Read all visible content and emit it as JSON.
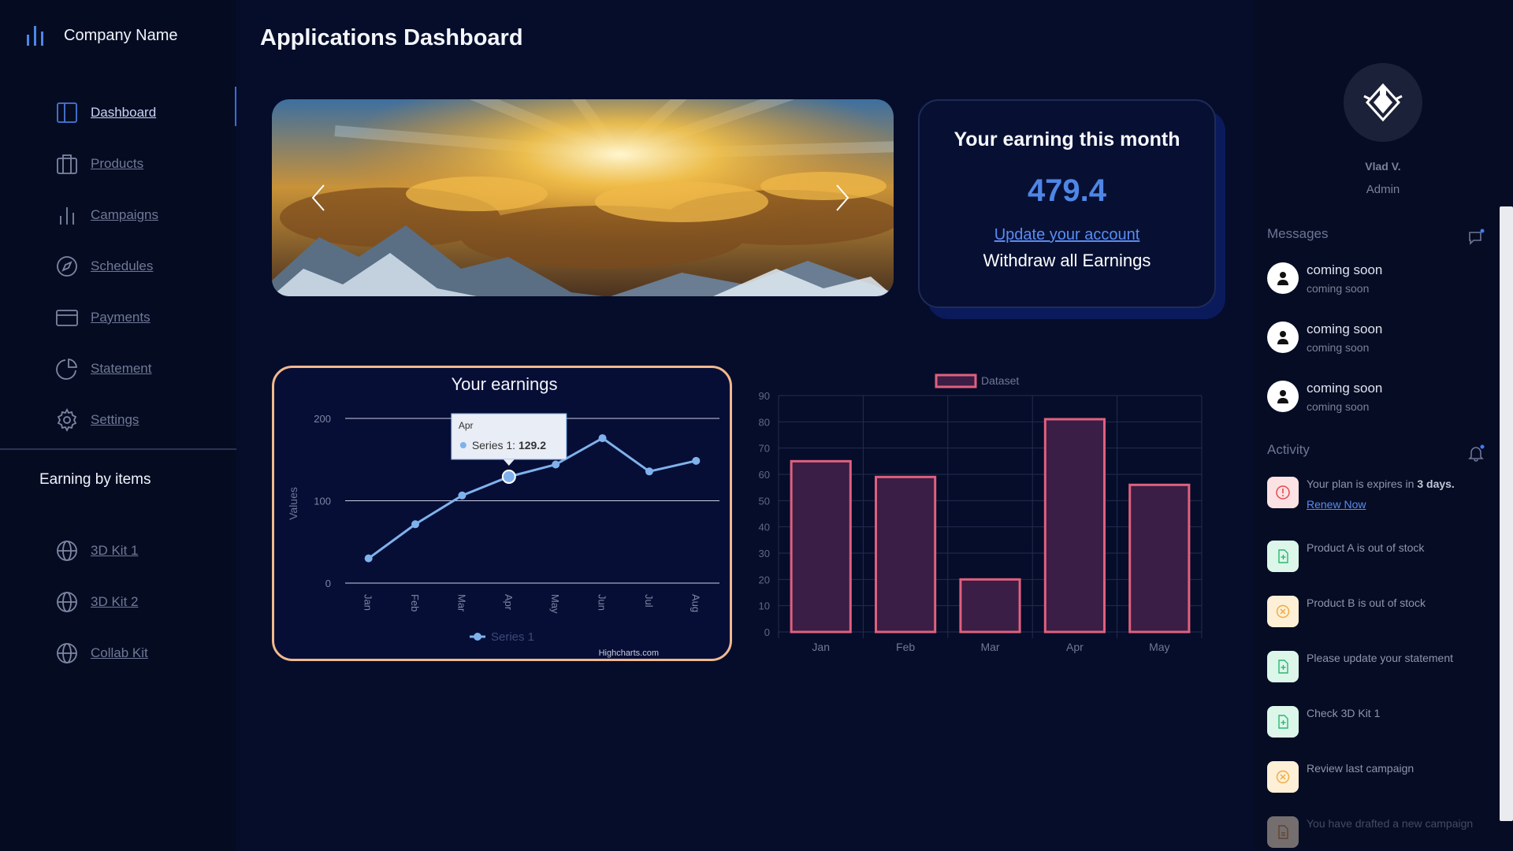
{
  "brand": {
    "name": "Company Name",
    "icon": "bar-chart-icon"
  },
  "page": {
    "title": "Applications Dashboard"
  },
  "nav": [
    {
      "label": "Dashboard",
      "icon": "layout-icon",
      "active": true
    },
    {
      "label": "Products",
      "icon": "briefcase-icon"
    },
    {
      "label": "Campaigns",
      "icon": "bar-chart-icon"
    },
    {
      "label": "Schedules",
      "icon": "compass-icon"
    },
    {
      "label": "Payments",
      "icon": "credit-card-icon"
    },
    {
      "label": "Statement",
      "icon": "pie-chart-icon"
    },
    {
      "label": "Settings",
      "icon": "gear-icon"
    }
  ],
  "earning_by_items": {
    "title": "Earning by items",
    "items": [
      {
        "label": "3D Kit 1",
        "icon": "globe-icon"
      },
      {
        "label": "3D Kit 2",
        "icon": "globe-icon"
      },
      {
        "label": "Collab Kit",
        "icon": "globe-icon"
      }
    ]
  },
  "earning_card": {
    "title": "Your earning this month",
    "value": "479.4",
    "link": "Update your account",
    "subtitle": "Withdraw all Earnings"
  },
  "profile": {
    "name": "Vlad V.",
    "role": "Admin"
  },
  "messages": {
    "title": "Messages",
    "items": [
      {
        "title": "coming soon",
        "subtitle": "coming soon"
      },
      {
        "title": "coming soon",
        "subtitle": "coming soon"
      },
      {
        "title": "coming soon",
        "subtitle": "coming soon"
      }
    ]
  },
  "activity": {
    "title": "Activity",
    "expiry_prefix": "Your plan is expires in ",
    "expiry_bold": "3 days.",
    "renew": "Renew Now",
    "items": [
      {
        "text": "Product A is out of stock",
        "kind": "file"
      },
      {
        "text": "Product B is out of stock",
        "kind": "cancel"
      },
      {
        "text": "Please update your statement",
        "kind": "file"
      },
      {
        "text": "Check 3D Kit 1",
        "kind": "file"
      },
      {
        "text": "Review last campaign",
        "kind": "cancel"
      },
      {
        "text": "You have drafted a new campaign",
        "kind": "draft"
      }
    ]
  },
  "colors": {
    "accent": "#4f86e6",
    "card_border": "#f1b88e",
    "bar_stroke": "#e0607e",
    "bar_fill": "#3a1e45",
    "line_series": "#7fb2ec"
  },
  "chart_data": [
    {
      "type": "line",
      "title": "Your earnings",
      "ylabel": "Values",
      "categories": [
        "Jan",
        "Feb",
        "Mar",
        "Apr",
        "May",
        "Jun",
        "Jul",
        "Aug"
      ],
      "series": [
        {
          "name": "Series 1",
          "values": [
            30,
            71.5,
            106.4,
            129.2,
            144,
            176,
            135.6,
            148.5
          ]
        }
      ],
      "y_ticks": [
        "0",
        "100",
        "200"
      ],
      "ylim": [
        0,
        200
      ],
      "tooltip": {
        "category": "Apr",
        "series": "Series 1",
        "value": "129.2"
      },
      "credit": "Highcharts.com",
      "legend": "bottom"
    },
    {
      "type": "bar",
      "categories": [
        "Jan",
        "Feb",
        "Mar",
        "Apr",
        "May"
      ],
      "series": [
        {
          "name": "Dataset",
          "values": [
            65,
            59,
            20,
            81,
            56
          ]
        }
      ],
      "y_ticks": [
        "0",
        "10",
        "20",
        "30",
        "40",
        "50",
        "60",
        "70",
        "80",
        "90"
      ],
      "ylim": [
        0,
        90
      ],
      "legend": "top"
    }
  ]
}
